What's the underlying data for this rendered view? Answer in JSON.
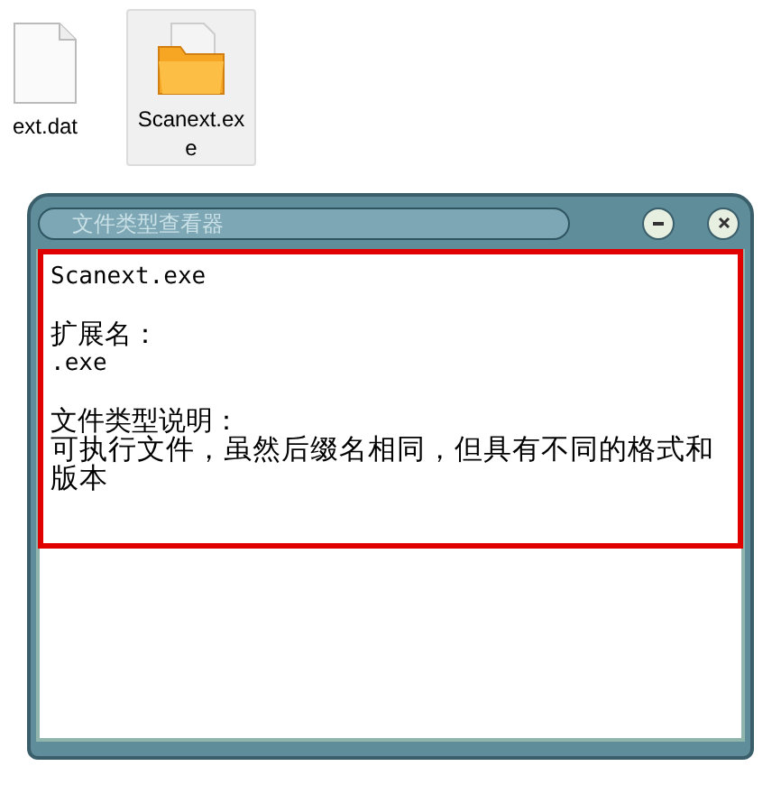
{
  "desktop_icons": [
    {
      "kind": "document",
      "label": "ext.dat",
      "selected": false
    },
    {
      "kind": "folder",
      "label": "Scanext.exe",
      "selected": true
    }
  ],
  "window": {
    "title": "文件类型查看器"
  },
  "info": {
    "file_name": "Scanext.exe",
    "extension_label": "扩展名：",
    "extension": ".exe",
    "description_label": "文件类型说明：",
    "description": "可执行文件，虽然后缀名相同，但具有不同的格式和版本"
  }
}
